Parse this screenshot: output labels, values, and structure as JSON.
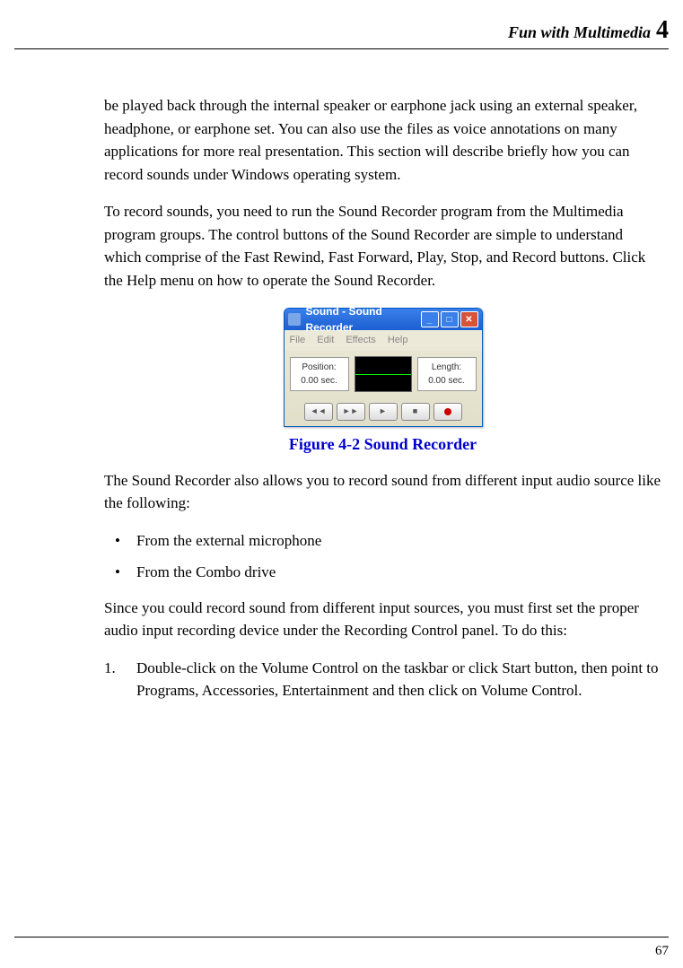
{
  "header": {
    "section": "Fun with Multimedia",
    "chapter": "4"
  },
  "p1": "be played back through the internal speaker or earphone jack using an external speaker, headphone, or earphone set. You can also use the files as voice annotations on many applications for more real presentation. This section will describe briefly how you can record sounds under Windows operating system.",
  "p2": "To record sounds, you need to run the Sound Recorder program from the Multimedia program groups. The control buttons of the Sound Recorder are simple to understand which comprise of the Fast Rewind, Fast Forward, Play, Stop, and Record buttons. Click the Help menu on how to operate the Sound Recorder.",
  "win": {
    "title": "Sound - Sound Recorder",
    "menu": [
      "File",
      "Edit",
      "Effects",
      "Help"
    ],
    "pos_label": "Position:",
    "pos_val": "0.00 sec.",
    "len_label": "Length:",
    "len_val": "0.00 sec."
  },
  "caption": "Figure 4-2    Sound Recorder",
  "p3": "The Sound Recorder also allows you to record sound from different input audio source like the following:",
  "bul": [
    "From the external microphone",
    "From the Combo drive"
  ],
  "p4": "Since you could record sound from different input sources, you must first set the proper audio input recording device under the Recording Control panel. To do this:",
  "step1_num": "1.",
  "step1": "Double-click on the Volume Control on the taskbar or click Start button, then point to Programs, Accessories, Entertainment and then click on Volume Control.",
  "pageno": "67"
}
